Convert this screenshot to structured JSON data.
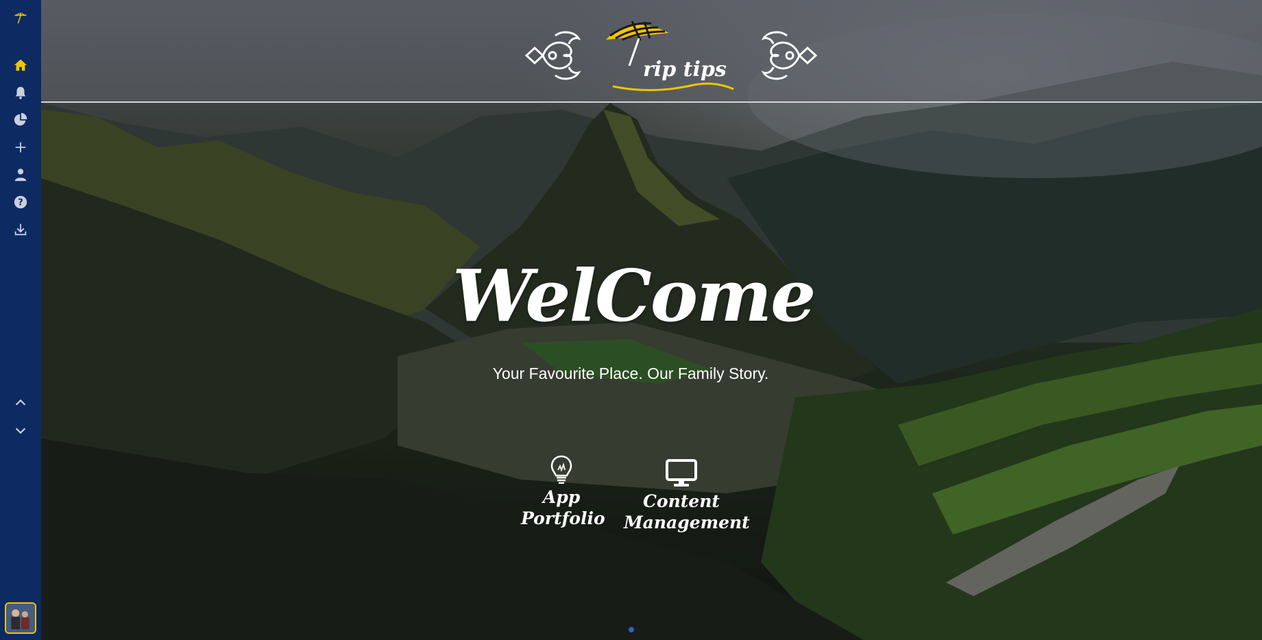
{
  "brand": {
    "logo_text": "rip tips",
    "accent": "#f2c400",
    "sidebar_bg": "#0e2a63"
  },
  "sidebar": {
    "items": [
      {
        "icon": "umbrella-icon"
      },
      {
        "icon": "home-icon",
        "active": true
      },
      {
        "icon": "bell-icon"
      },
      {
        "icon": "pie-chart-icon"
      },
      {
        "icon": "plus-icon"
      },
      {
        "icon": "user-icon"
      },
      {
        "icon": "help-icon"
      },
      {
        "icon": "download-icon"
      }
    ],
    "scroll": [
      {
        "icon": "chevron-up-icon"
      },
      {
        "icon": "chevron-down-icon"
      }
    ]
  },
  "hero": {
    "title": "WelCome",
    "tagline": "Your Favourite Place. Our Family Story."
  },
  "features": [
    {
      "label_line1": "App",
      "label_line2": "Portfolio",
      "icon": "lightbulb-icon"
    },
    {
      "label_line1": "Content",
      "label_line2": "Management",
      "icon": "monitor-icon"
    }
  ]
}
